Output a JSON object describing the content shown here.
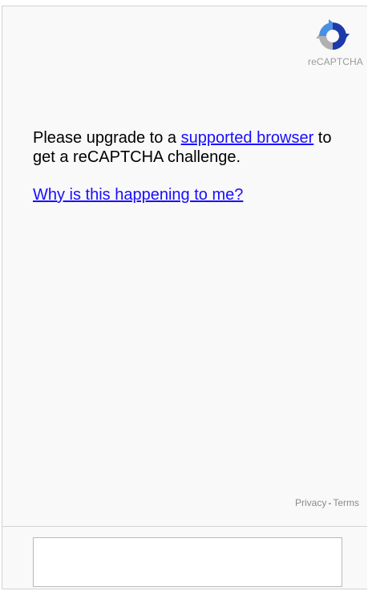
{
  "logo": {
    "label": "reCAPTCHA",
    "icon": "recaptcha-logo-icon",
    "colors": {
      "blue_dark": "#1c3aa9",
      "blue_light": "#4a90e2",
      "gray": "#b0b0b0"
    }
  },
  "message": {
    "before_link": "Please upgrade to a ",
    "link_text": "supported browser",
    "after_link": " to get a reCAPTCHA challenge."
  },
  "why_link": "Why is this happening to me?",
  "footer": {
    "privacy": "Privacy",
    "separator": "-",
    "terms": "Terms"
  },
  "colors": {
    "link": "#1a0dff",
    "panel_bg": "#f9f9f9",
    "border": "#d3d3d3"
  }
}
